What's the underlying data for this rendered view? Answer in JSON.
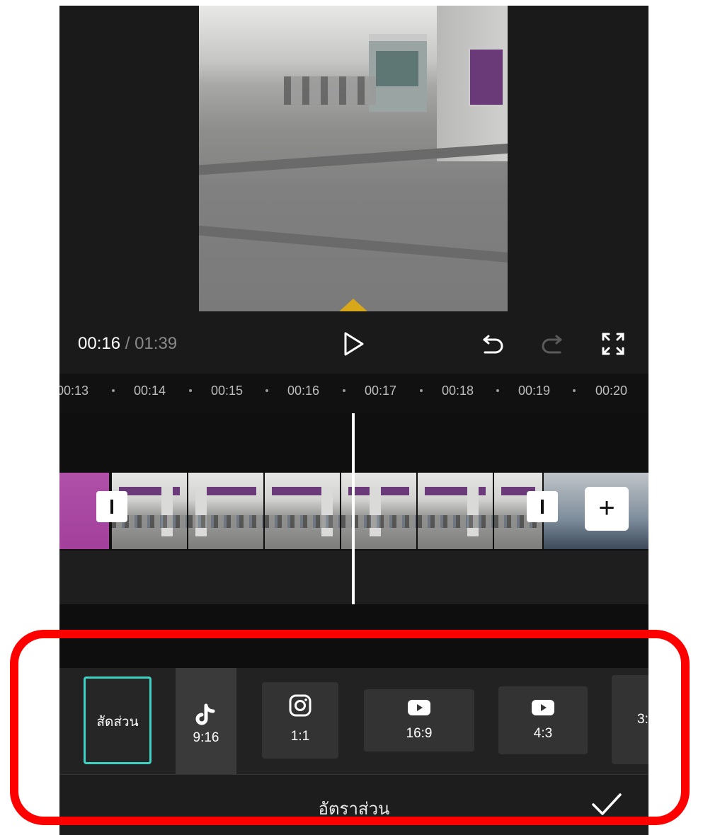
{
  "player": {
    "current_time": "00:16",
    "separator": "/",
    "total_time": "01:39"
  },
  "timeline": {
    "ticks": [
      "00:13",
      "00:14",
      "00:15",
      "00:16",
      "00:17",
      "00:18",
      "00:19",
      "00:20"
    ]
  },
  "ratio_panel": {
    "title": "อัตราส่วน",
    "options": [
      {
        "label": "สัดส่วน",
        "icon": "none",
        "selected": true
      },
      {
        "label": "9:16",
        "icon": "tiktok-icon",
        "selected": false
      },
      {
        "label": "1:1",
        "icon": "instagram-icon",
        "selected": false
      },
      {
        "label": "16:9",
        "icon": "youtube-icon",
        "selected": false
      },
      {
        "label": "4:3",
        "icon": "youtube-icon",
        "selected": false
      },
      {
        "label": "3:",
        "icon": "none",
        "selected": false
      }
    ]
  },
  "colors": {
    "accent": "#3fd1c4",
    "background": "#1a1a1a",
    "annotation": "#ff0000"
  }
}
